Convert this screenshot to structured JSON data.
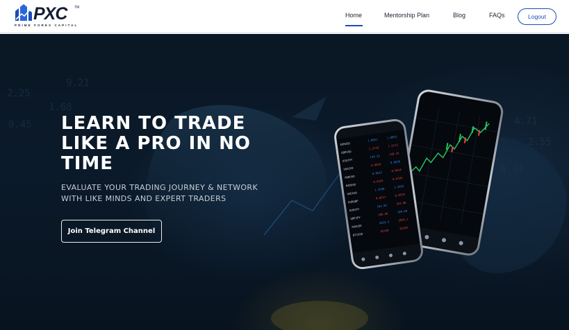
{
  "brand": {
    "name": "PXC",
    "tagline": "PRIME FOREX CAPITAL",
    "accent_color": "#1b4bb7",
    "logo_icon": "building-arrow-icon"
  },
  "nav": {
    "items": [
      {
        "label": "Home",
        "active": true
      },
      {
        "label": "Mentorship Plan",
        "active": false
      },
      {
        "label": "Blog",
        "active": false
      },
      {
        "label": "FAQs",
        "active": false
      }
    ],
    "logout_label": "Logout"
  },
  "hero": {
    "title": "LEARN TO TRADE LIKE A PRO IN NO TIME",
    "subtitle": "EVALUATE YOUR TRADING JOURNEY & NETWORK WITH LIKE MINDS AND EXPERT TRADERS",
    "cta_label": "Join Telegram Channel",
    "background": "bull-and-bear-market-image",
    "image": "trading-app-phones-image"
  }
}
